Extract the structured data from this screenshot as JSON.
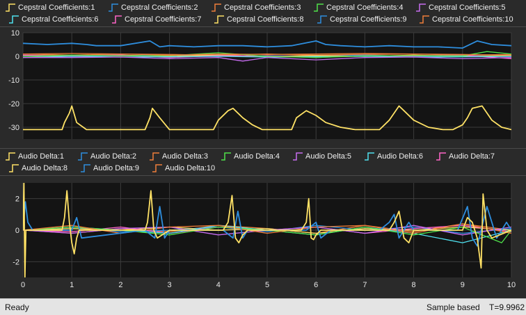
{
  "colors": {
    "background": "#2a2a2a",
    "plot_bg": "#141414",
    "grid": "#3c3c3c",
    "series": [
      "#ffe266",
      "#2e8ede",
      "#ef7e3a",
      "#4fe24a",
      "#c76cf0",
      "#4fe2f0",
      "#ff64c8",
      "#ffe266",
      "#2e8ede",
      "#ef7e3a"
    ]
  },
  "top_legend": [
    "Cepstral Coefficients:1",
    "Cepstral Coefficients:2",
    "Cepstral Coefficients:3",
    "Cepstral Coefficients:4",
    "Cepstral Coefficients:5",
    "Cepstral Coefficients:6",
    "Cepstral Coefficients:7",
    "Cepstral Coefficients:8",
    "Cepstral Coefficients:9",
    "Cepstral Coefficients:10"
  ],
  "bottom_legend": [
    "Audio Delta:1",
    "Audio Delta:2",
    "Audio Delta:3",
    "Audio Delta:4",
    "Audio Delta:5",
    "Audio Delta:6",
    "Audio Delta:7",
    "Audio Delta:8",
    "Audio Delta:9",
    "Audio Delta:10"
  ],
  "status": {
    "left": "Ready",
    "mode": "Sample based",
    "time": "T=9.9962"
  },
  "chart_data": [
    {
      "type": "line",
      "xlim": [
        0,
        10
      ],
      "ylim": [
        -35,
        10
      ],
      "ytick_labels": [
        "10",
        "0",
        "-10",
        "-20",
        "-30"
      ],
      "yticks": [
        10,
        0,
        -10,
        -20,
        -30
      ],
      "grid": true,
      "legend_position": "top",
      "series": [
        {
          "name": "Cepstral Coefficients:1",
          "x": [
            0,
            0.8,
            0.85,
            0.95,
            1.0,
            1.1,
            1.3,
            2.5,
            2.6,
            2.65,
            2.8,
            3.0,
            3.5,
            3.9,
            4.0,
            4.2,
            4.3,
            4.5,
            4.7,
            4.9,
            5.2,
            5.5,
            5.6,
            5.8,
            6.0,
            6.2,
            6.5,
            6.8,
            7.0,
            7.3,
            7.5,
            7.6,
            7.7,
            7.8,
            8.0,
            8.3,
            8.6,
            8.8,
            9.0,
            9.1,
            9.2,
            9.4,
            9.6,
            9.8,
            10.0
          ],
          "y": [
            -31,
            -31,
            -28,
            -24,
            -21,
            -28,
            -31,
            -31,
            -26,
            -22,
            -26,
            -31,
            -31,
            -31,
            -27,
            -23,
            -22,
            -26,
            -29,
            -31,
            -31,
            -31,
            -26,
            -23,
            -25,
            -28,
            -30,
            -31,
            -31,
            -31,
            -27,
            -24,
            -21,
            -23,
            -27,
            -30,
            -31,
            -31,
            -29,
            -26,
            -22,
            -21,
            -27,
            -30,
            -31
          ]
        },
        {
          "name": "Cepstral Coefficients:2",
          "x": [
            0,
            0.5,
            1.0,
            1.3,
            1.5,
            2.0,
            2.6,
            2.8,
            3.0,
            3.5,
            4.0,
            4.5,
            5.0,
            5.5,
            6.0,
            6.2,
            6.5,
            7.0,
            7.5,
            8.0,
            8.5,
            9.0,
            9.3,
            9.6,
            10.0
          ],
          "y": [
            5.5,
            5,
            5.5,
            5,
            4.5,
            4.5,
            6.5,
            4,
            4.5,
            4,
            4.5,
            4.5,
            4,
            4.5,
            6.5,
            5,
            4.5,
            4,
            4.5,
            4,
            4,
            3.5,
            6.5,
            5,
            4.5
          ]
        },
        {
          "name": "Cepstral Coefficients:3",
          "x": [
            0,
            1,
            2,
            3,
            4,
            5,
            6,
            7,
            8,
            9,
            10
          ],
          "y": [
            1,
            1.2,
            1,
            0.5,
            1,
            0.8,
            1,
            1.2,
            1,
            0.8,
            0.5
          ]
        },
        {
          "name": "Cepstral Coefficients:4",
          "x": [
            0,
            1,
            2,
            3,
            4,
            5,
            6,
            7,
            8,
            9,
            9.5,
            10
          ],
          "y": [
            0,
            0.5,
            0.2,
            0.3,
            1.5,
            0,
            -0.5,
            0.2,
            0.3,
            0.2,
            2,
            1
          ]
        },
        {
          "name": "Cepstral Coefficients:5",
          "x": [
            0,
            1,
            2,
            3,
            4,
            4.5,
            5,
            6,
            7,
            8,
            9,
            10
          ],
          "y": [
            -0.5,
            -0.5,
            -0.3,
            -1,
            -0.5,
            -2,
            -0.5,
            -1.5,
            -0.5,
            -0.3,
            -1,
            -0.5
          ]
        },
        {
          "name": "Cepstral Coefficients:6",
          "x": [
            0,
            1,
            2,
            3,
            4,
            5,
            6,
            7,
            8,
            9,
            10
          ],
          "y": [
            -0.5,
            0,
            -0.3,
            -0.2,
            0,
            -0.3,
            -0.2,
            0,
            -0.3,
            -0.2,
            0
          ]
        },
        {
          "name": "Cepstral Coefficients:7",
          "x": [
            0,
            1,
            2,
            3,
            4,
            5,
            6,
            7,
            8,
            9,
            10
          ],
          "y": [
            0.5,
            0.2,
            0.5,
            -0.5,
            0.3,
            0.2,
            -0.5,
            0.3,
            0.2,
            0.5,
            -1
          ]
        },
        {
          "name": "Cepstral Coefficients:8",
          "x": [
            0,
            1,
            2,
            3,
            4,
            5,
            6,
            7,
            8,
            9,
            10
          ],
          "y": [
            0,
            0.3,
            0.5,
            0,
            0.5,
            0,
            0.3,
            0,
            0.5,
            0,
            0.3
          ]
        },
        {
          "name": "Cepstral Coefficients:9",
          "x": [
            0,
            1,
            2,
            3,
            4,
            5,
            6,
            7,
            8,
            9,
            10
          ],
          "y": [
            0.3,
            0,
            0.3,
            0.5,
            0,
            0.3,
            0,
            0.5,
            0,
            0.3,
            0
          ]
        },
        {
          "name": "Cepstral Coefficients:10",
          "x": [
            0,
            1,
            2,
            3,
            4,
            5,
            6,
            7,
            8,
            9,
            10
          ],
          "y": [
            1,
            0.5,
            1,
            0.8,
            0.5,
            1,
            0.5,
            0.8,
            1,
            0.5,
            0.8
          ]
        }
      ]
    },
    {
      "type": "line",
      "xlim": [
        0,
        10
      ],
      "ylim": [
        -3,
        3
      ],
      "ytick_labels": [
        "2",
        "0",
        "-2"
      ],
      "yticks": [
        2,
        0,
        -2
      ],
      "xtick_labels": [
        "0",
        "1",
        "2",
        "3",
        "4",
        "5",
        "6",
        "7",
        "8",
        "9",
        "10"
      ],
      "xticks": [
        0,
        1,
        2,
        3,
        4,
        5,
        6,
        7,
        8,
        9,
        10
      ],
      "grid": true,
      "legend_position": "top",
      "series": [
        {
          "name": "Audio Delta:1",
          "x": [
            0,
            0.02,
            0.04,
            0.06,
            0.1,
            0.8,
            0.85,
            0.9,
            0.95,
            1.0,
            1.05,
            1.1,
            1.15,
            2.5,
            2.55,
            2.62,
            2.68,
            2.75,
            2.85,
            3.0,
            4.1,
            4.2,
            4.28,
            4.35,
            4.42,
            4.5,
            4.6,
            5.7,
            5.8,
            5.85,
            5.9,
            5.95,
            6.0,
            6.1,
            7.5,
            7.6,
            7.7,
            7.8,
            7.9,
            8.0,
            9.0,
            9.1,
            9.2,
            9.3,
            9.38,
            9.42,
            9.5,
            9.6,
            10.0
          ],
          "y": [
            0,
            3,
            -3,
            0,
            0,
            0,
            0.8,
            2.5,
            0.5,
            -0.8,
            -1.5,
            -0.5,
            0,
            0,
            0.5,
            2.5,
            0,
            -0.5,
            -0.3,
            0,
            0,
            0.5,
            2.2,
            -0.5,
            -0.8,
            -0.3,
            0,
            0,
            0.5,
            2.0,
            -0.5,
            -0.6,
            -0.3,
            0,
            0,
            0.5,
            1.2,
            -0.5,
            -0.8,
            0,
            0,
            0.8,
            0.5,
            -0.5,
            -2.4,
            2.3,
            0,
            -0.5,
            0
          ]
        },
        {
          "name": "Audio Delta:2",
          "x": [
            0,
            0.05,
            0.1,
            0.2,
            0.8,
            1.0,
            1.1,
            1.2,
            2.5,
            2.7,
            2.8,
            2.9,
            3.0,
            4.1,
            4.3,
            4.4,
            4.5,
            4.6,
            5.8,
            6.0,
            6.1,
            6.3,
            7.3,
            7.5,
            7.6,
            7.7,
            7.9,
            8.0,
            8.9,
            9.1,
            9.2,
            9.3,
            9.5,
            9.7,
            9.9,
            10.0
          ],
          "y": [
            0,
            1.8,
            0.5,
            0,
            0,
            0,
            0.8,
            -0.5,
            0,
            -0.5,
            1.5,
            -0.5,
            0,
            0,
            -0.5,
            1.2,
            -0.5,
            0,
            0,
            0.5,
            -0.5,
            0,
            0,
            0.5,
            1,
            -0.5,
            0.5,
            0,
            0,
            1.5,
            -0.5,
            -1,
            1.5,
            -0.5,
            0.5,
            0
          ]
        },
        {
          "name": "Audio Delta:3",
          "x": [
            0,
            1,
            2,
            3,
            4,
            5,
            6,
            7,
            8,
            9,
            10
          ],
          "y": [
            0,
            0.3,
            -0.2,
            0.2,
            0.3,
            -0.2,
            0.2,
            0.3,
            -0.2,
            0.4,
            -0.2
          ]
        },
        {
          "name": "Audio Delta:4",
          "x": [
            0,
            1,
            2,
            3,
            4,
            5,
            6,
            7,
            8,
            9,
            9.8,
            10
          ],
          "y": [
            0,
            0.2,
            0,
            -0.3,
            0.2,
            0,
            -0.3,
            0.2,
            -0.3,
            0.2,
            -0.8,
            0
          ]
        },
        {
          "name": "Audio Delta:5",
          "x": [
            0,
            1,
            2,
            3,
            4,
            5,
            6,
            7,
            8,
            9,
            10
          ],
          "y": [
            0,
            -0.2,
            0.1,
            0.2,
            -0.3,
            0,
            0.2,
            -0.2,
            0.3,
            -0.3,
            0.2
          ]
        },
        {
          "name": "Audio Delta:6",
          "x": [
            0,
            1,
            2,
            3,
            4,
            5,
            6,
            7,
            8,
            9,
            10
          ],
          "y": [
            0,
            0.2,
            0,
            -0.2,
            0.3,
            0,
            -0.3,
            0.2,
            -0.2,
            -0.8,
            0
          ]
        },
        {
          "name": "Audio Delta:7",
          "x": [
            0,
            1,
            2,
            3,
            4,
            5,
            6,
            7,
            8,
            9,
            10
          ],
          "y": [
            0,
            -0.1,
            0.2,
            -0.2,
            0.2,
            0,
            0.2,
            -0.2,
            0.1,
            0.3,
            -0.1
          ]
        },
        {
          "name": "Audio Delta:8",
          "x": [
            0,
            1,
            2,
            3,
            4,
            5,
            6,
            7,
            8,
            9,
            10
          ],
          "y": [
            0,
            0.1,
            0,
            0.2,
            0,
            0.1,
            -0.2,
            0.1,
            0,
            0.2,
            0
          ]
        },
        {
          "name": "Audio Delta:9",
          "x": [
            0,
            1,
            2,
            3,
            4,
            5,
            6,
            7,
            8,
            9,
            10
          ],
          "y": [
            0,
            0.2,
            -0.1,
            0,
            0.2,
            -0.1,
            0.3,
            0,
            0.2,
            -0.2,
            0.1
          ]
        },
        {
          "name": "Audio Delta:10",
          "x": [
            0,
            1,
            2,
            3,
            4,
            5,
            6,
            7,
            8,
            9,
            10
          ],
          "y": [
            0,
            -0.2,
            0.1,
            -0.1,
            0.3,
            0.1,
            -0.2,
            0.3,
            -0.1,
            0.4,
            0
          ]
        }
      ]
    }
  ]
}
